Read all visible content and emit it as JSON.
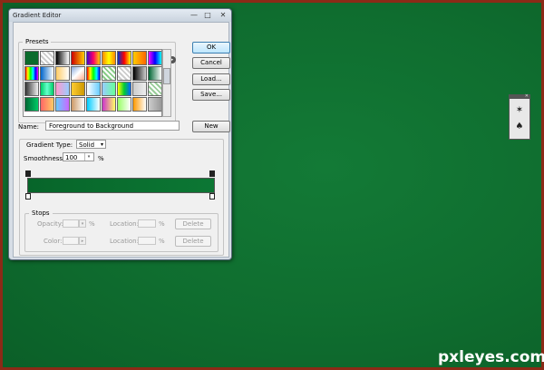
{
  "window": {
    "title": "Gradient Editor",
    "minimize_icon": "—",
    "maximize_icon": "□",
    "close_icon": "✕"
  },
  "presets": {
    "legend": "Presets",
    "menu_icon": "▸"
  },
  "buttons": {
    "ok": "OK",
    "cancel": "Cancel",
    "load": "Load...",
    "save": "Save...",
    "new": "New",
    "delete": "Delete"
  },
  "name": {
    "label": "Name:",
    "value": "Foreground to Background"
  },
  "gradient_type": {
    "label": "Gradient Type:",
    "value": "Solid"
  },
  "smoothness": {
    "label": "Smoothness:",
    "value": "100",
    "unit": "%"
  },
  "gradient": {
    "start_color": "#07652a",
    "end_color": "#0c7734"
  },
  "stops": {
    "legend": "Stops",
    "opacity_label": "Opacity:",
    "opacity_unit": "%",
    "color_label": "Color:",
    "location_label": "Location:",
    "location_unit": "%"
  },
  "watermark": "pxleyes.com"
}
